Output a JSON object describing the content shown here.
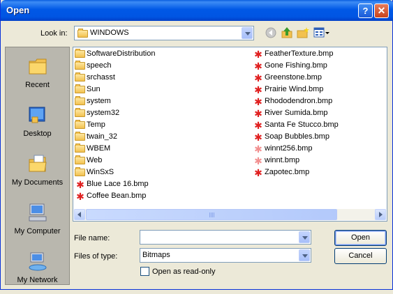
{
  "window": {
    "title": "Open",
    "help_glyph": "?",
    "close_glyph": "✕"
  },
  "lookin": {
    "label": "Look in:",
    "value": "WINDOWS"
  },
  "toolbar_icons": [
    "back-icon",
    "up-folder-icon",
    "new-folder-icon",
    "views-menu-icon"
  ],
  "places": [
    {
      "label": "Recent",
      "icon": "recent-documents-icon"
    },
    {
      "label": "Desktop",
      "icon": "desktop-icon"
    },
    {
      "label": "My Documents",
      "icon": "my-documents-icon"
    },
    {
      "label": "My Computer",
      "icon": "my-computer-icon"
    },
    {
      "label": "My Network",
      "icon": "my-network-icon"
    }
  ],
  "files_col1": [
    {
      "name": "SoftwareDistribution",
      "type": "folder"
    },
    {
      "name": "speech",
      "type": "folder"
    },
    {
      "name": "srchasst",
      "type": "folder"
    },
    {
      "name": "Sun",
      "type": "folder"
    },
    {
      "name": "system",
      "type": "folder"
    },
    {
      "name": "system32",
      "type": "folder"
    },
    {
      "name": "Temp",
      "type": "folder"
    },
    {
      "name": "twain_32",
      "type": "folder"
    },
    {
      "name": "WBEM",
      "type": "folder"
    },
    {
      "name": "Web",
      "type": "folder"
    },
    {
      "name": "WinSxS",
      "type": "folder"
    },
    {
      "name": "Blue Lace 16.bmp",
      "type": "bmp"
    },
    {
      "name": "Coffee Bean.bmp",
      "type": "bmp"
    }
  ],
  "files_col2": [
    {
      "name": "FeatherTexture.bmp",
      "type": "bmp"
    },
    {
      "name": "Gone Fishing.bmp",
      "type": "bmp"
    },
    {
      "name": "Greenstone.bmp",
      "type": "bmp"
    },
    {
      "name": "Prairie Wind.bmp",
      "type": "bmp"
    },
    {
      "name": "Rhododendron.bmp",
      "type": "bmp"
    },
    {
      "name": "River Sumida.bmp",
      "type": "bmp"
    },
    {
      "name": "Santa Fe Stucco.bmp",
      "type": "bmp"
    },
    {
      "name": "Soap Bubbles.bmp",
      "type": "bmp"
    },
    {
      "name": "winnt256.bmp",
      "type": "bmp-hidden"
    },
    {
      "name": "winnt.bmp",
      "type": "bmp-hidden"
    },
    {
      "name": "Zapotec.bmp",
      "type": "bmp"
    }
  ],
  "filename": {
    "label": "File name:",
    "value": ""
  },
  "filetype": {
    "label": "Files of type:",
    "value": "Bitmaps"
  },
  "readonly": {
    "label": "Open as read-only",
    "checked": false
  },
  "buttons": {
    "open": "Open",
    "cancel": "Cancel"
  }
}
